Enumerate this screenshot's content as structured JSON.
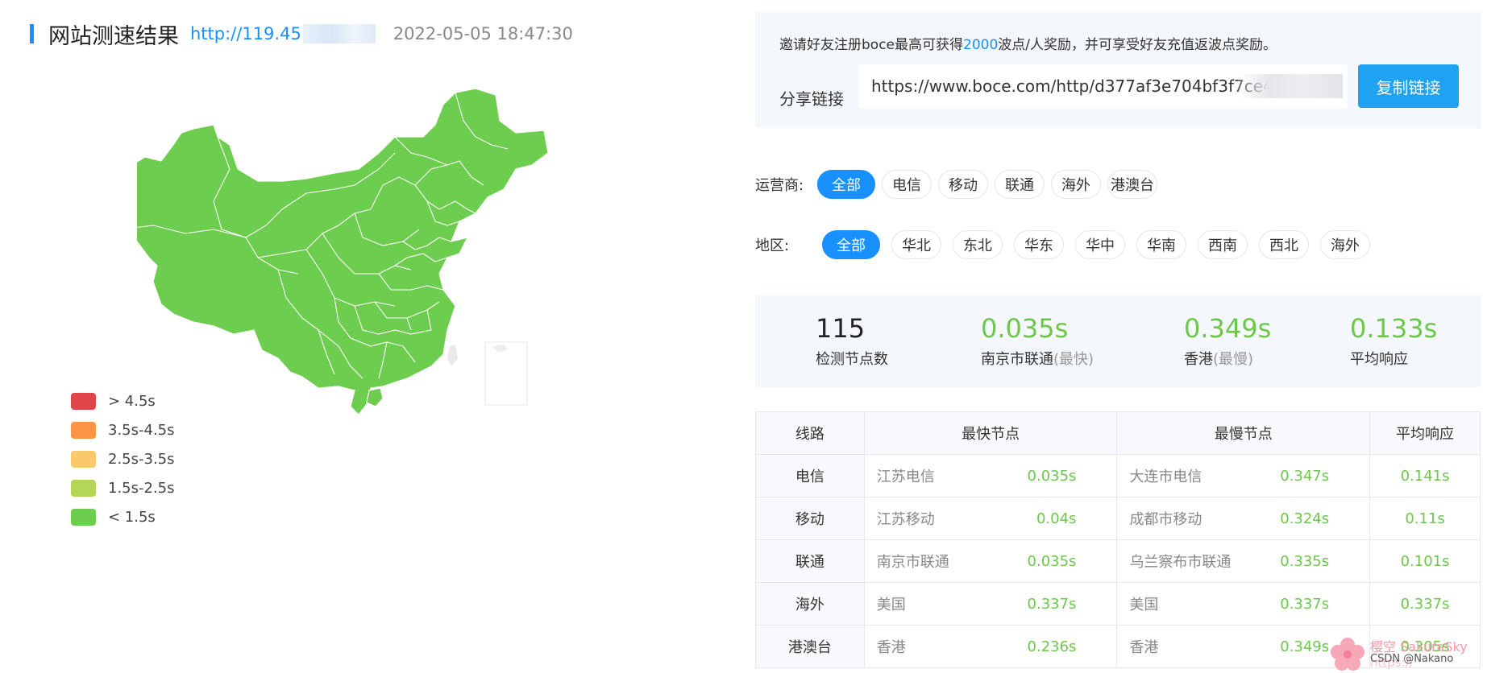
{
  "header": {
    "title": "网站测速结果",
    "url": "http://119.45",
    "datetime": "2022-05-05 18:47:30"
  },
  "map": {
    "fill_color": "#6dcd4e",
    "border_color": "#ffffff"
  },
  "legend": [
    {
      "label": "> 4.5s",
      "color": "#e04449"
    },
    {
      "label": "3.5s-4.5s",
      "color": "#fb9545"
    },
    {
      "label": "2.5s-3.5s",
      "color": "#f9c96b"
    },
    {
      "label": "1.5s-2.5s",
      "color": "#b2d656"
    },
    {
      "label": "< 1.5s",
      "color": "#6dcd4e"
    }
  ],
  "invite": {
    "text_before": "邀请好友注册boce最高可获得",
    "highlight": "2000",
    "text_after": "波点/人奖励，并可享受好友充值返波点奖励。",
    "share_label": "分享链接",
    "share_url": "https://www.boce.com/http/d377af3e704bf3f7ce4",
    "copy_button": "复制链接"
  },
  "filters": {
    "operator_label": "运营商:",
    "operators": [
      "全部",
      "电信",
      "移动",
      "联通",
      "海外",
      "港澳台"
    ],
    "operator_active": "全部",
    "region_label": "地区:",
    "regions": [
      "全部",
      "华北",
      "东北",
      "华东",
      "华中",
      "华南",
      "西南",
      "西北",
      "海外"
    ],
    "region_active": "全部"
  },
  "stats": {
    "nodes": {
      "value": "115",
      "label": "检测节点数"
    },
    "fastest": {
      "value": "0.035s",
      "label": "南京市联通",
      "sub": "(最快)"
    },
    "slowest": {
      "value": "0.349s",
      "label": "香港",
      "sub": "(最慢)"
    },
    "average": {
      "value": "0.133s",
      "label": "平均响应"
    }
  },
  "table": {
    "headers": [
      "线路",
      "最快节点",
      "最慢节点",
      "平均响应"
    ],
    "rows": [
      {
        "route": "电信",
        "fast_node": "江苏电信",
        "fast_time": "0.035s",
        "slow_node": "大连市电信",
        "slow_time": "0.347s",
        "avg": "0.141s"
      },
      {
        "route": "移动",
        "fast_node": "江苏移动",
        "fast_time": "0.04s",
        "slow_node": "成都市移动",
        "slow_time": "0.324s",
        "avg": "0.11s"
      },
      {
        "route": "联通",
        "fast_node": "南京市联通",
        "fast_time": "0.035s",
        "slow_node": "乌兰察布市联通",
        "slow_time": "0.335s",
        "avg": "0.101s"
      },
      {
        "route": "海外",
        "fast_node": "美国",
        "fast_time": "0.337s",
        "slow_node": "美国",
        "slow_time": "0.337s",
        "avg": "0.337s"
      },
      {
        "route": "港澳台",
        "fast_node": "香港",
        "fast_time": "0.236s",
        "slow_node": "香港",
        "slow_time": "0.349s",
        "avg": "0.305s"
      }
    ]
  },
  "watermark": {
    "line1": "樱空 SakuraSky",
    "line2": "CSDN @Nakano",
    "line3": "https://"
  }
}
